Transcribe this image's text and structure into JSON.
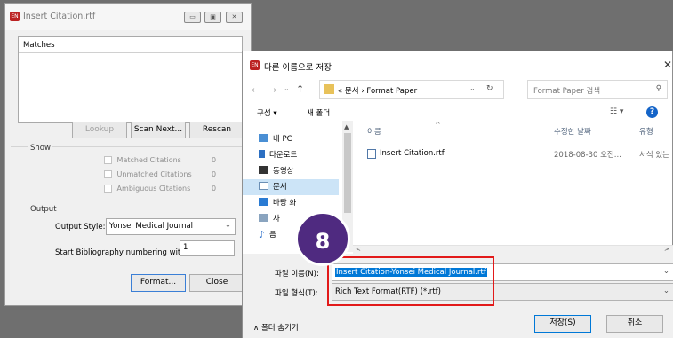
{
  "citation_window": {
    "title": "Insert Citation.rtf",
    "app_badge": "EN",
    "matches_header": "Matches",
    "buttons": {
      "lookup": "Lookup",
      "scan_next": "Scan Next...",
      "rescan": "Rescan"
    },
    "show_group": {
      "label": "Show",
      "rows": [
        {
          "label": "Matched Citations",
          "count": "0"
        },
        {
          "label": "Unmatched Citations",
          "count": "0"
        },
        {
          "label": "Ambiguous Citations",
          "count": "0"
        }
      ]
    },
    "output_group": {
      "label": "Output",
      "style_label": "Output Style:",
      "style_value": "Yonsei Medical Journal",
      "numbering_label": "Start Bibliography numbering with:",
      "numbering_value": "1"
    },
    "format_button": "Format...",
    "close_button": "Close"
  },
  "save_dialog": {
    "title": "다른 이름으로 저장",
    "breadcrumb": [
      "«",
      "문서",
      "›",
      "Format Paper"
    ],
    "search_placeholder": "Format Paper 검색",
    "toolbar": {
      "organize": "구성 ▾",
      "new_folder": "새 폴더"
    },
    "nav_items": [
      {
        "label": "내 PC",
        "icon": "pc-icon"
      },
      {
        "label": "다운로드",
        "icon": "download-icon"
      },
      {
        "label": "동영상",
        "icon": "video-icon"
      },
      {
        "label": "문서",
        "icon": "document-icon"
      },
      {
        "label": "바탕 화",
        "icon": "desktop-icon"
      },
      {
        "label": "사",
        "icon": "picture-icon"
      },
      {
        "label": "음",
        "icon": "music-icon"
      }
    ],
    "columns": {
      "name": "이름",
      "modified": "수정한 날짜",
      "type": "유형"
    },
    "files": [
      {
        "name": "Insert Citation.rtf",
        "modified": "2018-08-30 오전...",
        "type": "서식 있는"
      }
    ],
    "filename_label": "파일 이름(N):",
    "filename_value": "Insert Citation-Yonsei Medical Journal.rtf",
    "filetype_label": "파일 형식(T):",
    "filetype_value": "Rich Text Format(RTF) (*.rtf)",
    "hide_folders": "폴더 숨기기",
    "save_button": "저장(S)",
    "cancel_button": "취소"
  },
  "step_badge": "8",
  "colors": {
    "badge": "#4f2a80",
    "highlight": "#e21a1a",
    "selection": "#0078d7"
  }
}
